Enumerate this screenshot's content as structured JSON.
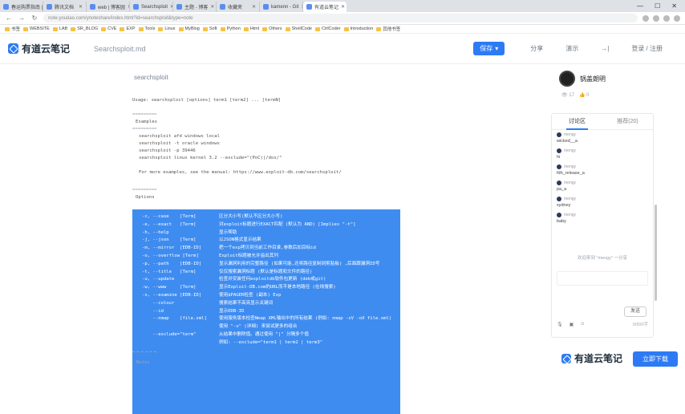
{
  "browser": {
    "tabs": [
      {
        "label": "春运购票指南 | 知乎"
      },
      {
        "label": "腾讯文档"
      },
      {
        "label": "web | 博客园"
      },
      {
        "label": "Searchsploit"
      },
      {
        "label": "主题 - 博客"
      },
      {
        "label": "收藏夹"
      },
      {
        "label": "kamenn - Git"
      },
      {
        "label": "有道云笔记",
        "active": true
      }
    ],
    "url": "note.youdao.com/ynoteshare/index.html?id=searchsploit&type=note",
    "bookmarks": [
      "书签",
      "WEBSITE",
      "LAB",
      "SR_BLOG",
      "CVE",
      "EXP",
      "Tools",
      "Linux",
      "MyBlog",
      "Soft",
      "Python",
      "Html",
      "Others",
      "ShellCode",
      "CtrlCoder",
      "Introduction",
      "其他书签"
    ],
    "window_controls": [
      "—",
      "☐",
      "✕"
    ]
  },
  "app": {
    "logo": "有道云笔记",
    "doc_title": "Searchsploit.md",
    "save_label": "保存",
    "share_label": "分享",
    "present_label": "演示",
    "export_label": "→|",
    "login_label": "登录 / 注册"
  },
  "document": {
    "heading": "searchsploit",
    "usage": "Usage: searchsploit [options] term1 [term2] ... [termN]",
    "examples_title": "Examples",
    "examples": [
      "searchsploit afd windows local",
      "searchsploit -t oracle windows",
      "searchsploit -p 39446",
      "searchsploit linux kernel 3.2 --exclude=\"(PoC)|/dos/\""
    ],
    "more_examples": "For more examples, see the manual: https://www.exploit-db.com/searchsploit/",
    "options_title": "Options",
    "options": [
      [
        "-c, --case    [Term]",
        "区分大小写(默认不区分大小写)"
      ],
      [
        "-e, --exact   [Term]",
        "对exploit标题进行EXACT匹配 (默认为 AND) [Implies \"-t\"]"
      ],
      [
        "-h, --help",
        "显示帮助"
      ],
      [
        "-j, --json    [Term]",
        "以JSON格式显示结果"
      ],
      [
        "-m, --mirror  [EDB-ID]",
        "把一个exp拷贝到当前工作目录,参数后加目标id"
      ],
      [
        "-o, --overflow [Term]",
        "Exploit标题被允许溢出其列"
      ],
      [
        "-p, --path    [EDB-ID]",
        "显示漏洞利用的完整路径 (如果可能,还将路径复制到剪贴板) ,后面跟漏洞ID号"
      ],
      [
        "-t, --title   [Term]",
        "仅仅搜索漏洞标题 (默认是标题和文件的路径)"
      ],
      [
        "-u, --update",
        "检查并安装任何exploitdb软件包更新 (deb或git)"
      ],
      [
        "-w, --www     [Term]",
        "显示Exploit-DB.com的URL而不是本地路径 (在线搜索)"
      ],
      [
        "-x, --examine [EDB-ID]",
        "使用$PAGER检查 (副本) Exp"
      ],
      [
        "    --colour",
        "搜索结果不高亮显示关键词"
      ],
      [
        "    --id",
        "显示EDB-ID"
      ],
      [
        "    --nmap    [file.xml]",
        "使用服务版本检查Nmap XML输出中的所有结果 (例如: nmap -sV -oX file.xml)"
      ],
      [
        "",
        "使用 \"-v\" (详细) 来尝试更多的组合"
      ],
      [
        "    --exclude=\"term\"",
        "从结果中删除值。通过使用 \"|\" 分隔多个值"
      ],
      [
        "",
        "例如: --exclude=\"term1 | term2 | term3\""
      ]
    ],
    "notes_title": "Notes"
  },
  "sidebar": {
    "author": "锅盖朗明",
    "views": "👁 17",
    "likes": "👍 0",
    "tabs": [
      {
        "label": "讨论区",
        "active": true
      },
      {
        "label": "推荐(20)"
      }
    ],
    "comments": [
      {
        "user": "mengy",
        "text": "wicked__a"
      },
      {
        "user": "mengy",
        "text": "hi"
      },
      {
        "user": "mengy",
        "text": "fdh_release_a"
      },
      {
        "user": "mengy",
        "text": "pa_a"
      },
      {
        "user": "mengy",
        "text": "sydney"
      },
      {
        "user": "mengy",
        "text": "baby"
      }
    ],
    "notice": "欢迎来到 \"mengy\" 一分享",
    "send_label": "发送",
    "char_count": "0/500字"
  },
  "footer": {
    "logo": "有道云笔记",
    "download_label": "立即下载"
  }
}
